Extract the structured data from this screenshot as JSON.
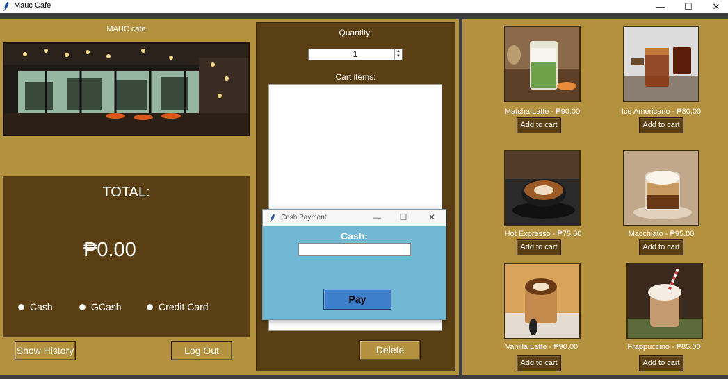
{
  "window": {
    "title": "Mauc Cafe",
    "minimize_glyph": "—",
    "maximize_glyph": "☐",
    "close_glyph": "✕"
  },
  "left": {
    "brand": "MAUC cafe",
    "total_label": "TOTAL:",
    "total_value": "₱0.00",
    "payment_options": [
      "Cash",
      "GCash",
      "Credit Card"
    ],
    "show_history_label": "Show History",
    "logout_label": "Log Out"
  },
  "middle": {
    "quantity_label": "Quantity:",
    "quantity_value": "1",
    "cart_label": "Cart items:",
    "delete_label": "Delete"
  },
  "products": [
    {
      "name": "Matcha Latte - ₱90.00",
      "add_label": "Add to cart"
    },
    {
      "name": "Ice Americano - ₱80.00",
      "add_label": "Add to cart"
    },
    {
      "name": "Hot Expresso - ₱75.00",
      "add_label": "Add to cart"
    },
    {
      "name": "Macchiato - ₱95.00",
      "add_label": "Add to cart"
    },
    {
      "name": "Vanilla Latte - ₱90.00",
      "add_label": "Add to cart"
    },
    {
      "name": "Frappuccino - ₱85.00",
      "add_label": "Add to cart"
    }
  ],
  "dialog": {
    "title": "Cash Payment",
    "cash_label": "Cash:",
    "cash_value": "",
    "pay_label": "Pay",
    "minimize_glyph": "—",
    "maximize_glyph": "☐",
    "close_glyph": "✕"
  },
  "colors": {
    "panel_tan": "#b3913f",
    "panel_brown": "#5a3f15",
    "dialog_blue": "#70b8d3",
    "pay_button": "#3e7fcc"
  }
}
